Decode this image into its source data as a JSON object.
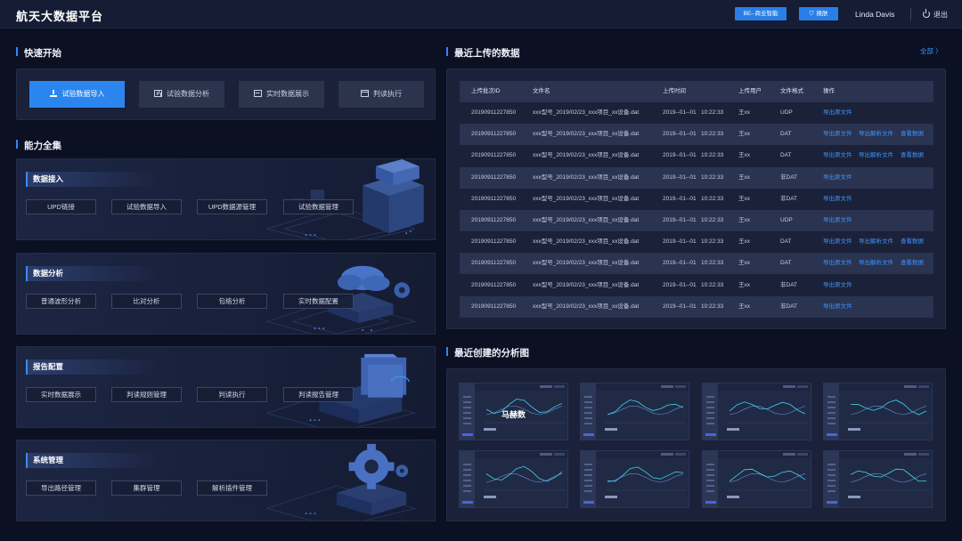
{
  "app": {
    "title": "航天大数据平台"
  },
  "topbar": {
    "bi_button": "BE--商业智能",
    "skin_button": "换肤",
    "user": "Linda Davis",
    "logout": "退出"
  },
  "quick_start": {
    "title": "快速开始",
    "buttons": [
      "试验数据导入",
      "试验数据分析",
      "实时数据展示",
      "判读执行"
    ]
  },
  "capabilities": {
    "title": "能力全集",
    "cards": [
      {
        "title": "数据接入",
        "items": [
          "UPD链接",
          "试验数据导入",
          "UPD数据源管理",
          "试验数据管理"
        ]
      },
      {
        "title": "数据分析",
        "items": [
          "普通波形分析",
          "比对分析",
          "包络分析",
          "实时数据配置"
        ]
      },
      {
        "title": "报告配置",
        "items": [
          "实时数据展示",
          "判读规则管理",
          "判读执行",
          "判读报告管理"
        ]
      },
      {
        "title": "系统管理",
        "items": [
          "导出路径管理",
          "集群管理",
          "解析插件管理"
        ]
      }
    ]
  },
  "recent_uploads": {
    "title": "最近上传的数据",
    "all_link": "全部 〉",
    "columns": [
      "上传批次ID",
      "文件名",
      "上传时间",
      "上传用户",
      "文件格式",
      "操作"
    ],
    "rows": [
      {
        "id": "20190911227850",
        "file": "xxx型号_2019/02/23_xxx项目_xx设备.dat",
        "date": "2019--01--01",
        "time": "10:22:33",
        "user": "王xx",
        "format": "UDP",
        "actions": [
          "导出原文件"
        ]
      },
      {
        "id": "20190911227850",
        "file": "xxx型号_2019/02/23_xxx项目_xx设备.dat",
        "date": "2019--01--01",
        "time": "10:22:33",
        "user": "王xx",
        "format": "DAT",
        "actions": [
          "导出原文件",
          "导出解析文件",
          "查看数据"
        ]
      },
      {
        "id": "20190911227850",
        "file": "xxx型号_2019/02/23_xxx项目_xx设备.dat",
        "date": "2019--01--01",
        "time": "10:22:33",
        "user": "王xx",
        "format": "DAT",
        "actions": [
          "导出原文件",
          "导出解析文件",
          "查看数据"
        ]
      },
      {
        "id": "20190911227850",
        "file": "xxx型号_2019/02/23_xxx项目_xx设备.dat",
        "date": "2019--01--01",
        "time": "10:22:33",
        "user": "王xx",
        "format": "非DAT",
        "actions": [
          "导出原文件"
        ]
      },
      {
        "id": "20190911227850",
        "file": "xxx型号_2019/02/23_xxx项目_xx设备.dat",
        "date": "2019--01--01",
        "time": "10:22:33",
        "user": "王xx",
        "format": "非DAT",
        "actions": [
          "导出原文件"
        ]
      },
      {
        "id": "20190911227850",
        "file": "xxx型号_2019/02/23_xxx项目_xx设备.dat",
        "date": "2019--01--01",
        "time": "10:22:33",
        "user": "王xx",
        "format": "UDP",
        "actions": [
          "导出原文件"
        ]
      },
      {
        "id": "20190911227850",
        "file": "xxx型号_2019/02/23_xxx项目_xx设备.dat",
        "date": "2019--01--01",
        "time": "10:22:33",
        "user": "王xx",
        "format": "DAT",
        "actions": [
          "导出原文件",
          "导出解析文件",
          "查看数据"
        ]
      },
      {
        "id": "20190911227850",
        "file": "xxx型号_2019/02/23_xxx项目_xx设备.dat",
        "date": "2019--01--01",
        "time": "10:22:33",
        "user": "王xx",
        "format": "DAT",
        "actions": [
          "导出原文件",
          "导出解析文件",
          "查看数据"
        ]
      },
      {
        "id": "20190911227850",
        "file": "xxx型号_2019/02/23_xxx项目_xx设备.dat",
        "date": "2019--01--01",
        "time": "10:22:33",
        "user": "王xx",
        "format": "非DAT",
        "actions": [
          "导出原文件"
        ]
      },
      {
        "id": "20190911227850",
        "file": "xxx型号_2019/02/23_xxx项目_xx设备.dat",
        "date": "2019--01--01",
        "time": "10:22:33",
        "user": "王xx",
        "format": "非DAT",
        "actions": [
          "导出原文件"
        ]
      }
    ]
  },
  "recent_charts": {
    "title": "最近创建的分析图",
    "highlight_label": "马赫数",
    "thumbnails": 8
  },
  "colors": {
    "accent": "#2a86ee",
    "link": "#3d95ff",
    "background": "#0b1022",
    "panel": "#1a2139"
  },
  "icons": [
    "download-icon",
    "bar-chart-icon",
    "wave-chart-icon",
    "window-icon",
    "shirt-icon",
    "power-icon"
  ]
}
